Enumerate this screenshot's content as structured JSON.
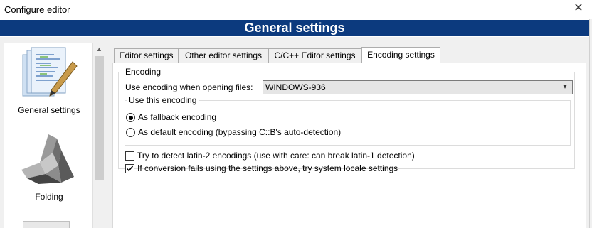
{
  "window": {
    "title": "Configure editor",
    "close_glyph": "✕"
  },
  "header": {
    "title": "General settings"
  },
  "categories": [
    {
      "label": "General settings",
      "icon": "document-pencil-icon",
      "selected": true
    },
    {
      "label": "Folding",
      "icon": "origami-bird-icon",
      "selected": false
    }
  ],
  "tabs": [
    {
      "label": "Editor settings",
      "active": false
    },
    {
      "label": "Other editor settings",
      "active": false
    },
    {
      "label": "C/C++ Editor settings",
      "active": false
    },
    {
      "label": "Encoding settings",
      "active": true
    }
  ],
  "encoding": {
    "group_title": "Encoding",
    "use_encoding_label": "Use encoding when opening files:",
    "use_encoding_value": "WINDOWS-936",
    "use_this_group_title": "Use this encoding",
    "fallback_label": "As fallback encoding",
    "fallback_checked": true,
    "default_label": "As default encoding (bypassing C::B's auto-detection)",
    "default_checked": false,
    "latin2_label": "Try to detect latin-2 encodings (use with care: can break latin-1 detection)",
    "latin2_checked": false,
    "system_locale_label": "If conversion fails using the settings above, try system locale settings",
    "system_locale_checked": true
  }
}
